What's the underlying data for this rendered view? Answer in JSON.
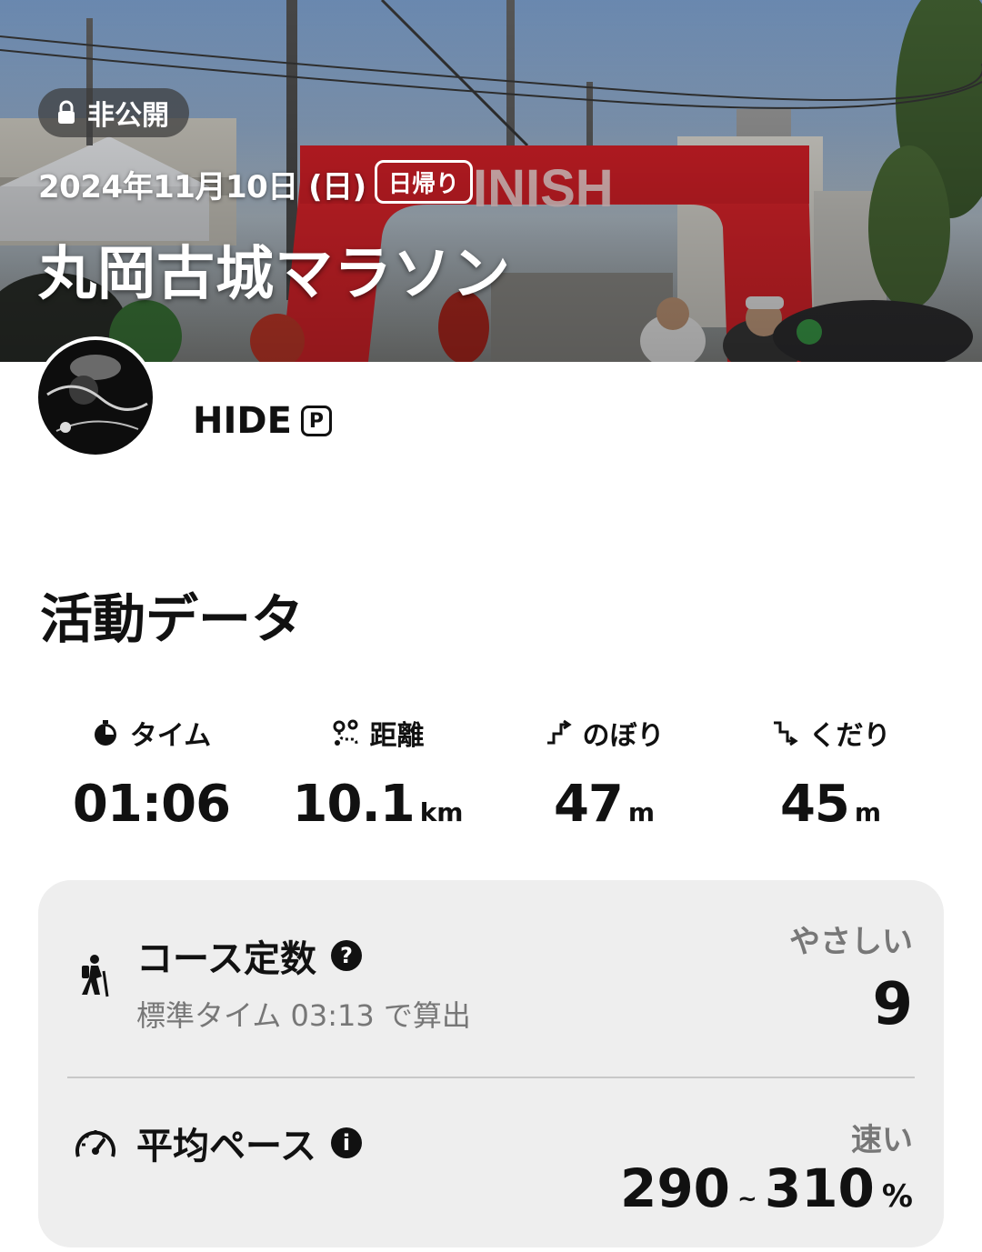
{
  "hero": {
    "privacy_label": "非公開",
    "date": "2024年11月10日 (日)",
    "trip_type": "日帰り",
    "title": "丸岡古城マラソン",
    "banner_text": "INISH"
  },
  "profile": {
    "username": "HIDE",
    "badge": "P"
  },
  "activity": {
    "section_title": "活動データ",
    "stats": [
      {
        "icon": "stopwatch-icon",
        "label": "タイム",
        "value": "01:06",
        "unit": ""
      },
      {
        "icon": "route-icon",
        "label": "距離",
        "value": "10.1",
        "unit": "km"
      },
      {
        "icon": "ascent-icon",
        "label": "のぼり",
        "value": "47",
        "unit": "m"
      },
      {
        "icon": "descent-icon",
        "label": "くだり",
        "value": "45",
        "unit": "m"
      }
    ]
  },
  "card": {
    "course": {
      "title": "コース定数",
      "help": "?",
      "subtitle": "標準タイム 03:13 で算出",
      "grade": "やさしい",
      "value": "9"
    },
    "pace": {
      "title": "平均ペース",
      "info": "i",
      "grade": "速い",
      "min": "290",
      "tilde": "~",
      "max": "310",
      "unit": "%"
    }
  }
}
